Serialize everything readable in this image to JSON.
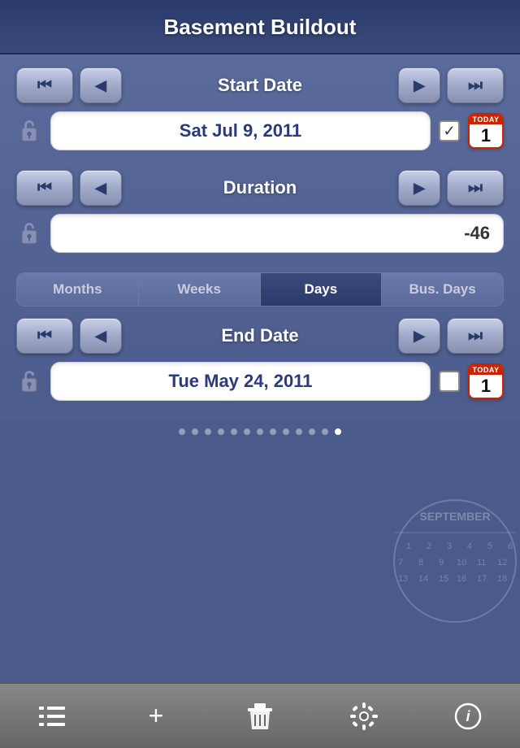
{
  "header": {
    "title": "Basement Buildout"
  },
  "start_date_section": {
    "label": "Start Date",
    "date_value": "Sat Jul 9, 2011",
    "checkbox_checked": true,
    "today_label": "TODAY",
    "today_num": "1"
  },
  "duration_section": {
    "label": "Duration",
    "value": "-46"
  },
  "segment": {
    "options": [
      "Months",
      "Weeks",
      "Days",
      "Bus. Days"
    ],
    "active_index": 2
  },
  "end_date_section": {
    "label": "End Date",
    "date_value": "Tue May 24, 2011",
    "checkbox_checked": false,
    "today_label": "TODAY",
    "today_num": "1"
  },
  "dots": {
    "count": 13,
    "active_index": 12
  },
  "toolbar": {
    "items": [
      {
        "name": "list-icon",
        "symbol": "≡"
      },
      {
        "name": "add-icon",
        "symbol": "+"
      },
      {
        "name": "trash-icon",
        "symbol": "🗑"
      },
      {
        "name": "settings-icon",
        "symbol": "⚙"
      },
      {
        "name": "info-icon",
        "symbol": "ℹ"
      }
    ]
  }
}
